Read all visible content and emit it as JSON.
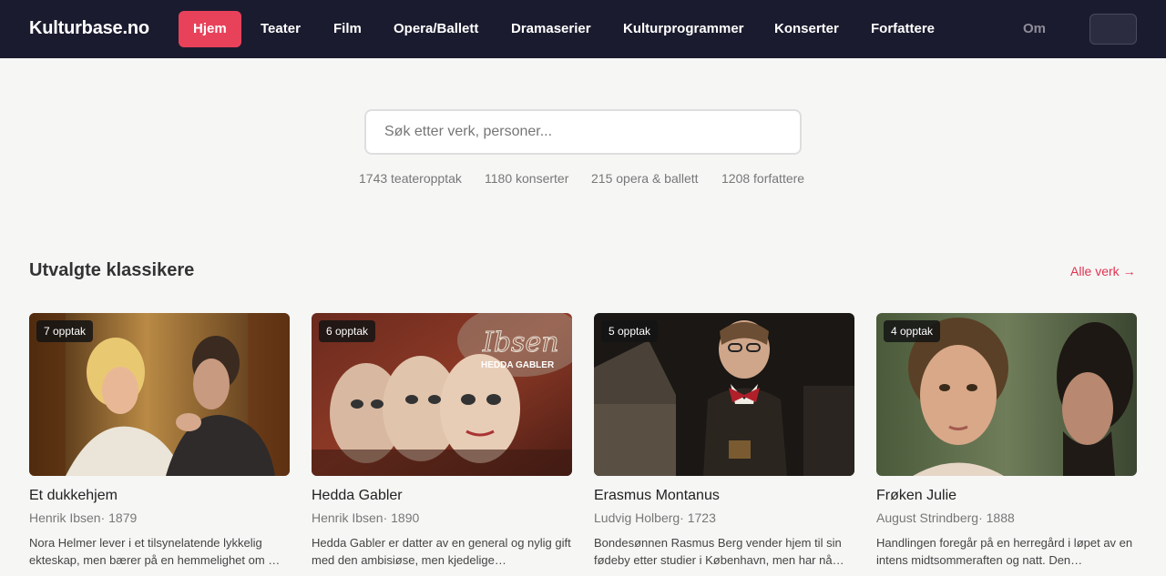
{
  "site": {
    "logo": "Kulturbase.no"
  },
  "nav": {
    "items": [
      "Hjem",
      "Teater",
      "Film",
      "Opera/Ballett",
      "Dramaserier",
      "Kulturprogrammer",
      "Konserter",
      "Forfattere"
    ],
    "active": "Hjem",
    "om": "Om"
  },
  "search": {
    "placeholder": "Søk etter verk, personer..."
  },
  "stats": [
    "1743 teateropptak",
    "1180 konserter",
    "215 opera & ballett",
    "1208 forfattere"
  ],
  "section": {
    "title": "Utvalgte klassikere",
    "link": "Alle verk →"
  },
  "cards": [
    {
      "badge": "7 opptak",
      "title": "Et dukkehjem",
      "meta": "Henrik Ibsen· 1879",
      "desc": "Nora Helmer lever i et tilsynelatende lykkelig ekteskap, men bærer på en hemmelighet om …"
    },
    {
      "badge": "6 opptak",
      "title": "Hedda Gabler",
      "meta": "Henrik Ibsen· 1890",
      "desc": "Hedda Gabler er datter av en general og nylig gift med den ambisiøse, men kjedelige…",
      "image_text": [
        "Ibsen",
        "HEDDA GABLER"
      ]
    },
    {
      "badge": "5 opptak",
      "title": "Erasmus Montanus",
      "meta": "Ludvig Holberg· 1723",
      "desc": "Bondesønnen Rasmus Berg vender hjem til sin fødeby etter studier i København, men har nå…"
    },
    {
      "badge": "4 opptak",
      "title": "Frøken Julie",
      "meta": "August Strindberg· 1888",
      "desc": "Handlingen foregår på en herregård i løpet av en intens midtsommeraften og natt. Den…"
    }
  ],
  "colors": {
    "navbar": "#1b1b2f",
    "accent": "#e8425b",
    "background": "#f6f6f5"
  }
}
